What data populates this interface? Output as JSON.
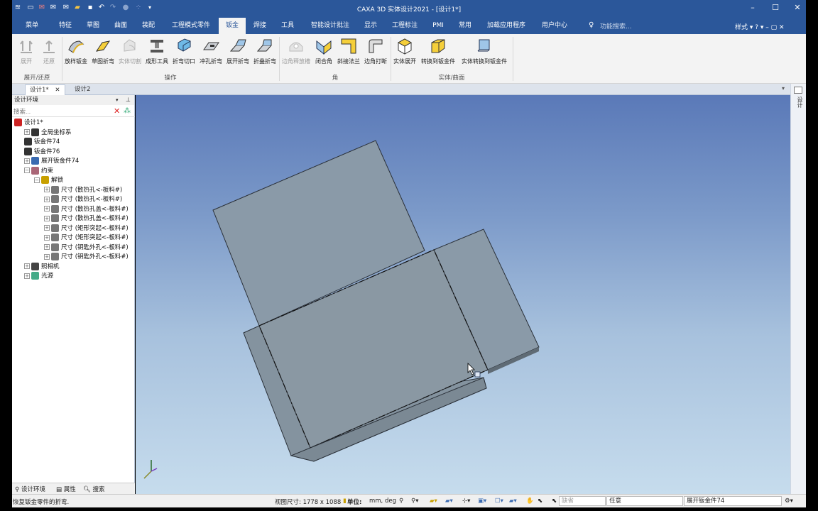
{
  "app": {
    "title": "CAXA 3D 实体设计2021 - [设计1*]",
    "accent": "#2b579a"
  },
  "ribbon_tabs": [
    {
      "label": "菜单"
    },
    {
      "label": "特征"
    },
    {
      "label": "草图"
    },
    {
      "label": "曲面"
    },
    {
      "label": "装配"
    },
    {
      "label": "工程模式零件"
    },
    {
      "label": "钣金",
      "active": true
    },
    {
      "label": "焊接"
    },
    {
      "label": "工具"
    },
    {
      "label": "智能设计批注"
    },
    {
      "label": "显示"
    },
    {
      "label": "工程标注"
    },
    {
      "label": "PMI"
    },
    {
      "label": "常用"
    },
    {
      "label": "加载应用程序"
    },
    {
      "label": "用户中心"
    }
  ],
  "function_search": {
    "placeholder": "功能搜索..."
  },
  "style_menu": "样式",
  "ribbon_groups": [
    {
      "label": "展开/还原",
      "buttons": [
        {
          "label": "展开",
          "disabled": true
        },
        {
          "label": "还原",
          "disabled": true
        }
      ]
    },
    {
      "label": "操作",
      "buttons": [
        {
          "label": "放样钣金"
        },
        {
          "label": "草图折弯"
        },
        {
          "label": "实体切割",
          "disabled": true
        },
        {
          "label": "成形工具"
        },
        {
          "label": "折弯切口"
        },
        {
          "label": "冲孔折弯"
        },
        {
          "label": "展开折弯"
        },
        {
          "label": "折叠折弯"
        }
      ]
    },
    {
      "label": "角",
      "buttons": [
        {
          "label": "边角释放槽",
          "disabled": true
        },
        {
          "label": "闭合角"
        },
        {
          "label": "斜接法兰"
        },
        {
          "label": "边角打断"
        }
      ]
    },
    {
      "label": "实体/曲面",
      "buttons": [
        {
          "label": "实体展开"
        },
        {
          "label": "转换到钣金件"
        },
        {
          "label": "实体转换到钣金件"
        }
      ]
    }
  ],
  "doc_tabs": [
    {
      "label": "设计1*",
      "active": true
    },
    {
      "label": "设计2"
    }
  ],
  "left_panel": {
    "title": "设计环境",
    "search_placeholder": "搜索...",
    "tree": [
      {
        "label": "设计1*",
        "level": 0,
        "icon": "design-icon"
      },
      {
        "label": "全局坐标系",
        "level": 1,
        "expander": "+",
        "icon": "axes-icon"
      },
      {
        "label": "钣金件74",
        "level": 1,
        "icon": "sheetmetal-icon"
      },
      {
        "label": "钣金件76",
        "level": 1,
        "icon": "sheetmetal-icon"
      },
      {
        "label": "展开钣金件74",
        "level": 1,
        "expander": "+",
        "icon": "unfold-icon"
      },
      {
        "label": "约束",
        "level": 1,
        "expander": "-",
        "icon": "constraint-icon"
      },
      {
        "label": "解锁",
        "level": 2,
        "expander": "-",
        "icon": "unlock-icon"
      },
      {
        "label": "尺寸 (散热孔<-板料#)",
        "level": 3,
        "expander": "+",
        "icon": "lock-icon"
      },
      {
        "label": "尺寸 (散热孔<-板料#)",
        "level": 3,
        "expander": "+",
        "icon": "lock-icon"
      },
      {
        "label": "尺寸 (散热孔盖<-板料#)",
        "level": 3,
        "expander": "+",
        "icon": "lock-icon"
      },
      {
        "label": "尺寸 (散热孔盖<-板料#)",
        "level": 3,
        "expander": "+",
        "icon": "lock-icon"
      },
      {
        "label": "尺寸 (矩形突起<-板料#)",
        "level": 3,
        "expander": "+",
        "icon": "lock-icon"
      },
      {
        "label": "尺寸 (矩形突起<-板料#)",
        "level": 3,
        "expander": "+",
        "icon": "lock-icon"
      },
      {
        "label": "尺寸 (钥匙外孔<-板料#)",
        "level": 3,
        "expander": "+",
        "icon": "lock-icon"
      },
      {
        "label": "尺寸 (钥匙外孔<-板料#)",
        "level": 3,
        "expander": "+",
        "icon": "lock-icon"
      },
      {
        "label": "照相机",
        "level": 1,
        "expander": "+",
        "icon": "camera-icon"
      },
      {
        "label": "光源",
        "level": 1,
        "expander": "+",
        "icon": "light-icon"
      }
    ],
    "bottom_tabs": [
      "设计环境",
      "属性",
      "搜索"
    ]
  },
  "right_strip_label": "设计",
  "status": {
    "message": "恢复钣金零件的折弯.",
    "view_size": "视图尺寸: 1778 x 1088",
    "unit_label": "单位:",
    "unit_value": "mm, deg",
    "default_combo": "缺省",
    "filter_combo": "任意",
    "part_combo": "展开钣金件74"
  }
}
